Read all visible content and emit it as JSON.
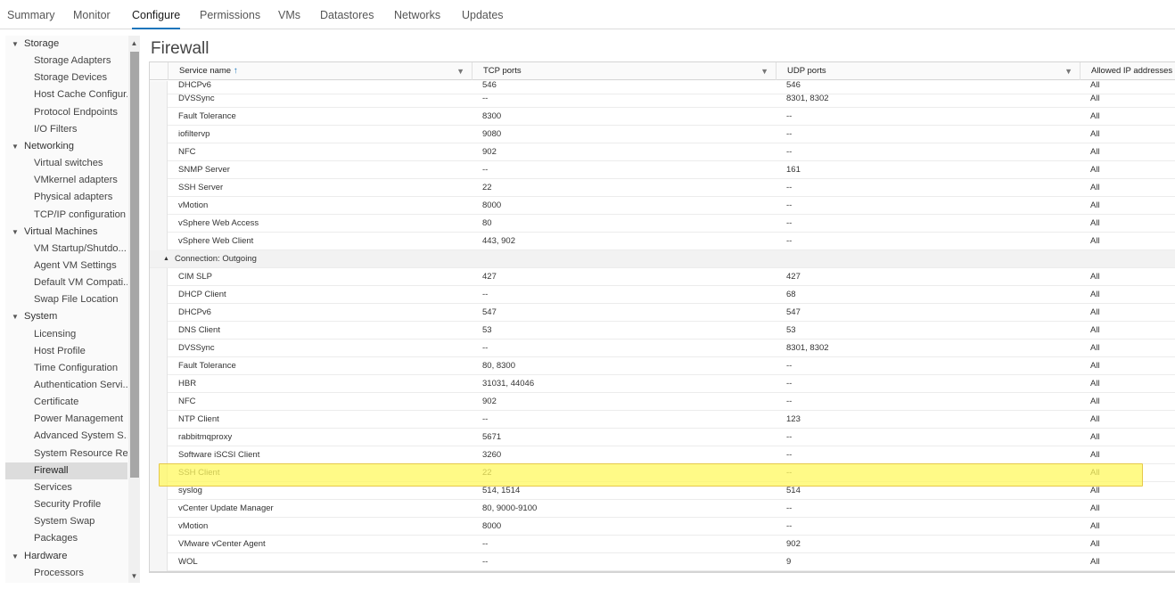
{
  "tabs": [
    "Summary",
    "Monitor",
    "Configure",
    "Permissions",
    "VMs",
    "Datastores",
    "Networks",
    "Updates"
  ],
  "active_tab": "Configure",
  "sidebar": [
    {
      "type": "group",
      "label": "Storage"
    },
    {
      "type": "item",
      "label": "Storage Adapters"
    },
    {
      "type": "item",
      "label": "Storage Devices"
    },
    {
      "type": "item",
      "label": "Host Cache Configur..."
    },
    {
      "type": "item",
      "label": "Protocol Endpoints"
    },
    {
      "type": "item",
      "label": "I/O Filters"
    },
    {
      "type": "group",
      "label": "Networking"
    },
    {
      "type": "item",
      "label": "Virtual switches"
    },
    {
      "type": "item",
      "label": "VMkernel adapters"
    },
    {
      "type": "item",
      "label": "Physical adapters"
    },
    {
      "type": "item",
      "label": "TCP/IP configuration"
    },
    {
      "type": "group",
      "label": "Virtual Machines"
    },
    {
      "type": "item",
      "label": "VM Startup/Shutdo..."
    },
    {
      "type": "item",
      "label": "Agent VM Settings"
    },
    {
      "type": "item",
      "label": "Default VM Compati..."
    },
    {
      "type": "item",
      "label": "Swap File Location"
    },
    {
      "type": "group",
      "label": "System"
    },
    {
      "type": "item",
      "label": "Licensing"
    },
    {
      "type": "item",
      "label": "Host Profile"
    },
    {
      "type": "item",
      "label": "Time Configuration"
    },
    {
      "type": "item",
      "label": "Authentication Servi..."
    },
    {
      "type": "item",
      "label": "Certificate"
    },
    {
      "type": "item",
      "label": "Power Management"
    },
    {
      "type": "item",
      "label": "Advanced System S..."
    },
    {
      "type": "item",
      "label": "System Resource Re..."
    },
    {
      "type": "item",
      "label": "Firewall",
      "selected": true
    },
    {
      "type": "item",
      "label": "Services"
    },
    {
      "type": "item",
      "label": "Security Profile"
    },
    {
      "type": "item",
      "label": "System Swap"
    },
    {
      "type": "item",
      "label": "Packages"
    },
    {
      "type": "group",
      "label": "Hardware"
    },
    {
      "type": "item",
      "label": "Processors"
    }
  ],
  "page_title": "Firewall",
  "columns": [
    "Service name",
    "TCP ports",
    "UDP ports",
    "Allowed IP addresses"
  ],
  "rows": [
    {
      "name": "DHCPv6",
      "tcp": "546",
      "udp": "546",
      "ip": "All"
    },
    {
      "name": "DVSSync",
      "tcp": "--",
      "udp": "8301, 8302",
      "ip": "All"
    },
    {
      "name": "Fault Tolerance",
      "tcp": "8300",
      "udp": "--",
      "ip": "All"
    },
    {
      "name": "iofiltervp",
      "tcp": "9080",
      "udp": "--",
      "ip": "All"
    },
    {
      "name": "NFC",
      "tcp": "902",
      "udp": "--",
      "ip": "All"
    },
    {
      "name": "SNMP Server",
      "tcp": "--",
      "udp": "161",
      "ip": "All"
    },
    {
      "name": "SSH Server",
      "tcp": "22",
      "udp": "--",
      "ip": "All"
    },
    {
      "name": "vMotion",
      "tcp": "8000",
      "udp": "--",
      "ip": "All"
    },
    {
      "name": "vSphere Web Access",
      "tcp": "80",
      "udp": "--",
      "ip": "All"
    },
    {
      "name": "vSphere Web Client",
      "tcp": "443, 902",
      "udp": "--",
      "ip": "All"
    },
    {
      "group": "Connection: Outgoing"
    },
    {
      "name": "CIM SLP",
      "tcp": "427",
      "udp": "427",
      "ip": "All"
    },
    {
      "name": "DHCP Client",
      "tcp": "--",
      "udp": "68",
      "ip": "All"
    },
    {
      "name": "DHCPv6",
      "tcp": "547",
      "udp": "547",
      "ip": "All"
    },
    {
      "name": "DNS Client",
      "tcp": "53",
      "udp": "53",
      "ip": "All"
    },
    {
      "name": "DVSSync",
      "tcp": "--",
      "udp": "8301, 8302",
      "ip": "All"
    },
    {
      "name": "Fault Tolerance",
      "tcp": "80, 8300",
      "udp": "--",
      "ip": "All"
    },
    {
      "name": "HBR",
      "tcp": "31031, 44046",
      "udp": "--",
      "ip": "All"
    },
    {
      "name": "NFC",
      "tcp": "902",
      "udp": "--",
      "ip": "All"
    },
    {
      "name": "NTP Client",
      "tcp": "--",
      "udp": "123",
      "ip": "All"
    },
    {
      "name": "rabbitmqproxy",
      "tcp": "5671",
      "udp": "--",
      "ip": "All"
    },
    {
      "name": "Software iSCSI Client",
      "tcp": "3260",
      "udp": "--",
      "ip": "All"
    },
    {
      "name": "SSH Client",
      "tcp": "22",
      "udp": "--",
      "ip": "All",
      "highlighted": true
    },
    {
      "name": "syslog",
      "tcp": "514, 1514",
      "udp": "514",
      "ip": "All"
    },
    {
      "name": "vCenter Update Manager",
      "tcp": "80, 9000-9100",
      "udp": "--",
      "ip": "All"
    },
    {
      "name": "vMotion",
      "tcp": "8000",
      "udp": "--",
      "ip": "All"
    },
    {
      "name": "VMware vCenter Agent",
      "tcp": "--",
      "udp": "902",
      "ip": "All"
    },
    {
      "name": "WOL",
      "tcp": "--",
      "udp": "9",
      "ip": "All"
    }
  ],
  "colors": {
    "accent": "#1b75bb",
    "highlight": "#fff85f",
    "selected_bg": "#dcdcdc"
  }
}
